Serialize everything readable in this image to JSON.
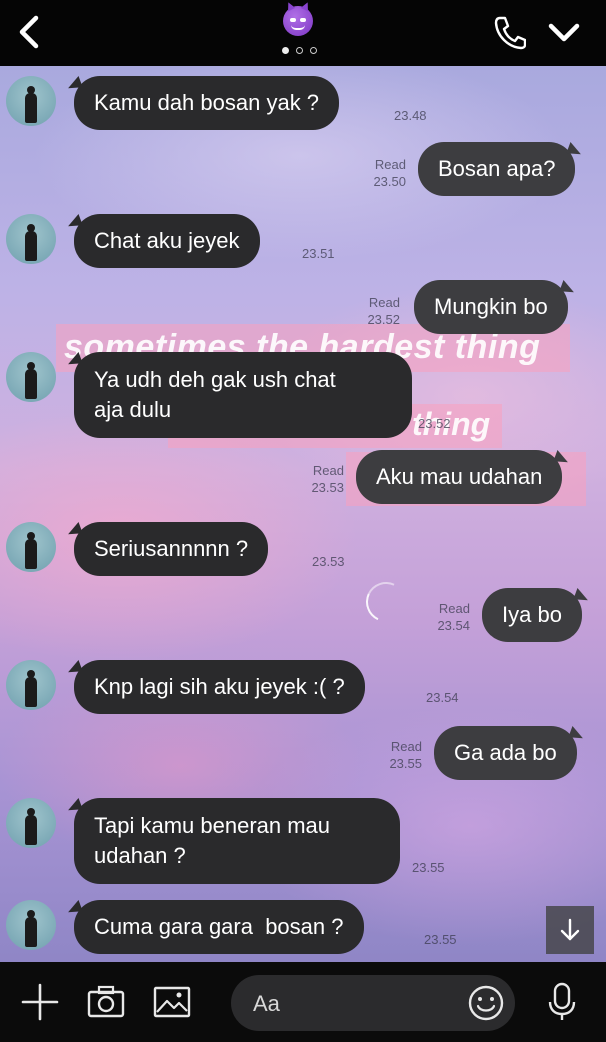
{
  "header": {
    "back_icon": "chevron-left-icon",
    "contact_emoji": "smiling-devil-emoji",
    "page_indicator": {
      "count": 3,
      "active": 0
    },
    "call_icon": "phone-icon",
    "menu_icon": "chevron-down-icon"
  },
  "background": {
    "overlay_text": [
      "sometimes the hardest thing",
      "thing"
    ]
  },
  "messages": [
    {
      "side": "in",
      "text": "Kamu dah bosan yak ?",
      "time": "23.48"
    },
    {
      "side": "out",
      "text": "Bosan apa?",
      "status": "Read",
      "time": "23.50"
    },
    {
      "side": "in",
      "text": "Chat aku jeyek",
      "time": "23.51"
    },
    {
      "side": "out",
      "text": "Mungkin bo",
      "status": "Read",
      "time": "23.52"
    },
    {
      "side": "in",
      "lines": [
        "Ya udh deh gak ush chat",
        "aja dulu"
      ],
      "time": "23.52"
    },
    {
      "side": "out",
      "text": "Aku mau udahan",
      "status": "Read",
      "time": "23.53"
    },
    {
      "side": "in",
      "text": "Seriusannnnn ?",
      "time": "23.53"
    },
    {
      "side": "out",
      "text": "Iya bo",
      "status": "Read",
      "time": "23.54"
    },
    {
      "side": "in",
      "text": "Knp lagi sih aku jeyek :( ?",
      "time": "23.54"
    },
    {
      "side": "out",
      "text": "Ga ada bo",
      "status": "Read",
      "time": "23.55"
    },
    {
      "side": "in",
      "lines": [
        "Tapi kamu beneran mau",
        "udahan ?"
      ],
      "time": "23.55"
    },
    {
      "side": "in",
      "text": "Cuma gara gara  bosan ?",
      "time": "23.55"
    }
  ],
  "input_bar": {
    "plus_icon": "plus-icon",
    "camera_icon": "camera-icon",
    "gallery_icon": "image-icon",
    "placeholder": "Aa",
    "emoji_icon": "smiley-icon",
    "mic_icon": "microphone-icon"
  },
  "scroll_icon": "arrow-down-icon"
}
